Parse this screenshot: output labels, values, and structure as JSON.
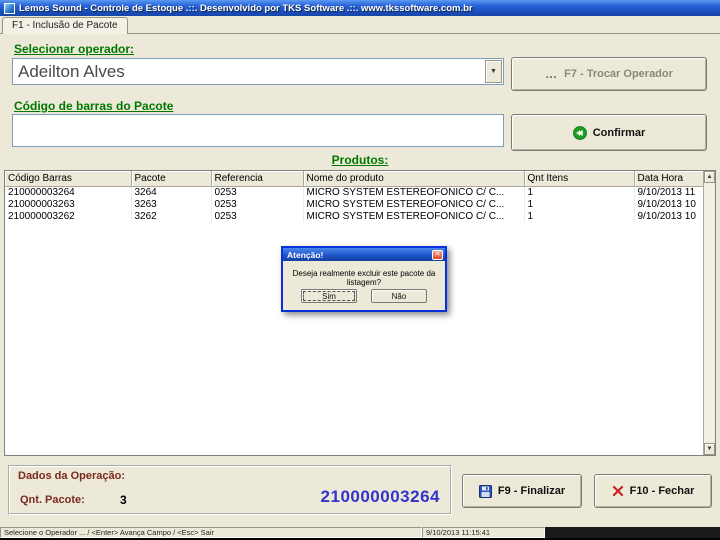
{
  "window": {
    "title": "Lemos Sound - Controle de Estoque .::. Desenvolvido por TKS Software .::. www.tkssoftware.com.br"
  },
  "tab": {
    "label": "F1 - Inclusão de Pacote"
  },
  "operator": {
    "label": "Selecionar operador:",
    "value": "Adeilton Alves",
    "change_button": "F7 - Trocar Operador"
  },
  "barcode": {
    "label": "Código de barras do Pacote",
    "value": "",
    "confirm_button": "Confirmar"
  },
  "products": {
    "label": "Produtos:",
    "columns": [
      "Código Barras",
      "Pacote",
      "Referencia",
      "Nome do produto",
      "Qnt Itens",
      "Data Hora"
    ],
    "rows": [
      [
        "210000003264",
        "3264",
        "0253",
        "MICRO SYSTEM ESTEREOFONICO C/ C...",
        "1",
        "9/10/2013 11"
      ],
      [
        "210000003263",
        "3263",
        "0253",
        "MICRO SYSTEM ESTEREOFONICO C/ C...",
        "1",
        "9/10/2013 10"
      ],
      [
        "210000003262",
        "3262",
        "0253",
        "MICRO SYSTEM ESTEREOFONICO C/ C...",
        "1",
        "9/10/2013 10"
      ]
    ]
  },
  "dialog": {
    "title": "Atenção!",
    "message": "Deseja realmente excluir este pacote da listagem?",
    "yes_button": "Sim",
    "no_button": "Não"
  },
  "operation": {
    "label": "Dados da Operação:",
    "qty_label": "Qnt. Pacote:",
    "qty_value": "3",
    "current_package": "210000003264"
  },
  "actions": {
    "finalize": "F9 - Finalizar",
    "close": "F10 - Fechar"
  },
  "statusbar": {
    "left": "Selecione o Operador ... / <Enter> Avança Campo / <Esc> Sair",
    "datetime": "9/10/2013 11:15:41"
  },
  "icons": {
    "combo_arrow": "chevron-down",
    "confirm": "green-circle-arrow",
    "finalize": "blue-floppy-disk",
    "close": "red-x",
    "dialog_close": "close-x",
    "trocar": "ellipsis"
  }
}
